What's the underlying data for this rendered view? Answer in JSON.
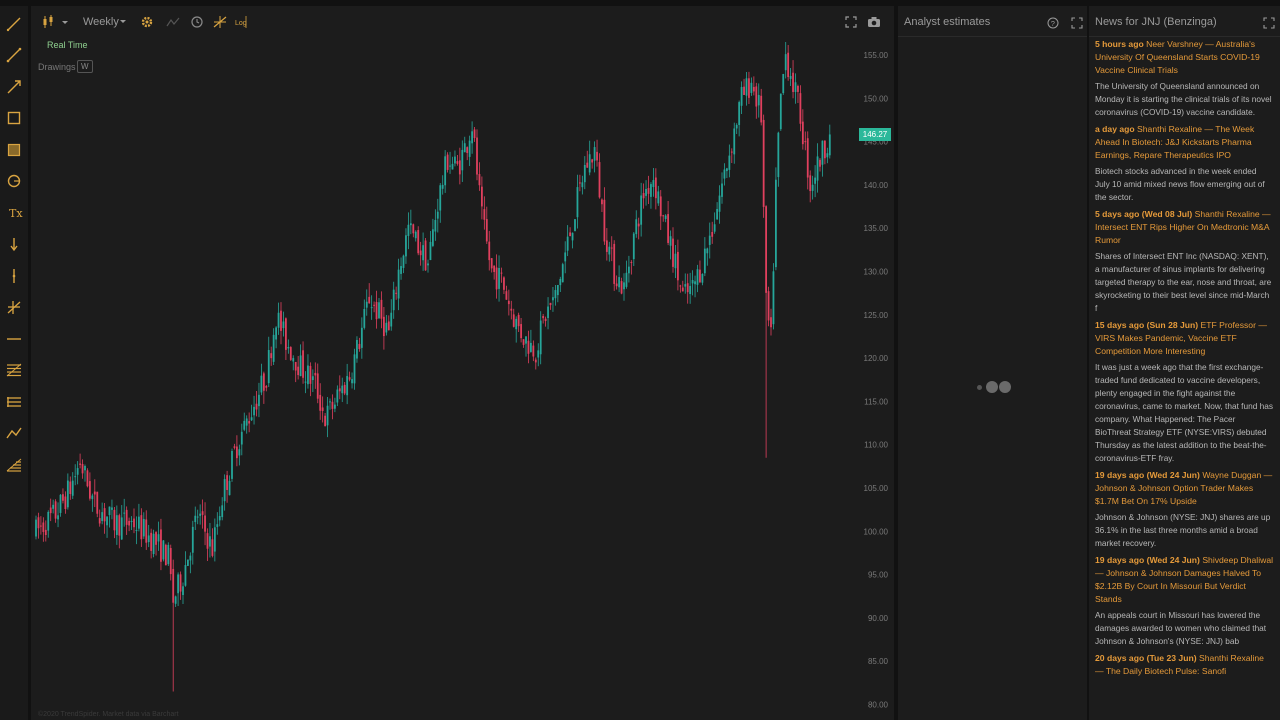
{
  "chart": {
    "timeframe": "Weekly",
    "log_label": "Log",
    "realtime_label": "Real Time",
    "drawings_label": "Drawings",
    "drawings_key": "W",
    "last_price": "146.27",
    "price_axis": [
      "155.00",
      "150.00",
      "145.00",
      "140.00",
      "135.00",
      "130.00",
      "125.00",
      "120.00",
      "115.00",
      "110.00",
      "105.00",
      "100.00",
      "95.00",
      "90.00",
      "85.00",
      "80.00"
    ],
    "copyright": "©2020 TrendSpider. Market data via Barchart",
    "up_color": "#26a69a",
    "down_color": "#e0405e"
  },
  "analyst": {
    "title": "Analyst estimates"
  },
  "news": {
    "title": "News for JNJ (Benzinga)",
    "items": [
      {
        "time": "5 hours ago",
        "headline": "Neer Varshney — Australia's University Of Queensland Starts COVID-19 Vaccine Clinical Trials",
        "summary": "The University of Queensland announced on Monday it is starting the clinical trials of its novel coronavirus (COVID-19) vaccine candidate."
      },
      {
        "time": "a day ago",
        "headline": "Shanthi Rexaline — The Week Ahead In Biotech: J&J Kickstarts Pharma Earnings, Repare Therapeutics IPO",
        "summary": "Biotech stocks advanced in the week ended July 10 amid mixed news flow emerging out of the sector."
      },
      {
        "time": "5 days ago (Wed 08 Jul)",
        "headline": "Shanthi Rexaline — Intersect ENT Rips Higher On Medtronic M&A Rumor",
        "summary": "Shares of Intersect ENT Inc (NASDAQ: XENT), a manufacturer of sinus implants for delivering targeted therapy to the ear, nose and throat, are skyrocketing to their best level since mid-March f"
      },
      {
        "time": "15 days ago (Sun 28 Jun)",
        "headline": "ETF Professor — VIRS Makes Pandemic, Vaccine ETF Competition More Interesting",
        "summary": "It was just a week ago that the first exchange-traded fund dedicated to vaccine developers, plenty engaged in the fight against the coronavirus, came to market. Now, that fund has company. What Happened: The Pacer BioThreat Strategy ETF (NYSE:VIRS) debuted Thursday as the latest addition to the beat-the-coronavirus-ETF fray."
      },
      {
        "time": "19 days ago (Wed 24 Jun)",
        "headline": "Wayne Duggan — Johnson & Johnson Option Trader Makes $1.7M Bet On 17% Upside",
        "summary": "Johnson & Johnson (NYSE: JNJ) shares are up 36.1% in the last three months amid a broad market recovery."
      },
      {
        "time": "19 days ago (Wed 24 Jun)",
        "headline": "Shivdeep Dhaliwal — Johnson & Johnson Damages Halved To $2.12B By Court In Missouri But Verdict Stands",
        "summary": "An appeals court in Missouri has lowered the damages awarded to women who claimed that Johnson & Johnson's (NYSE: JNJ) bab"
      },
      {
        "time": "20 days ago (Tue 23 Jun)",
        "headline": "Shanthi Rexaline — The Daily Biotech Pulse: Sanofi",
        "summary": ""
      }
    ]
  },
  "tools": [
    {
      "name": "pencil-tool-icon"
    },
    {
      "name": "trendline-tool-icon"
    },
    {
      "name": "ray-tool-icon"
    },
    {
      "name": "rectangle-tool-icon"
    },
    {
      "name": "fill-rectangle-tool-icon"
    },
    {
      "name": "circle-tool-icon"
    },
    {
      "name": "text-tool-icon"
    },
    {
      "name": "arrow-down-tool-icon"
    },
    {
      "name": "vertical-line-tool-icon"
    },
    {
      "name": "cross-line-tool-icon"
    },
    {
      "name": "horizontal-line-tool-icon"
    },
    {
      "name": "fibonacci-tool-icon"
    },
    {
      "name": "channel-tool-icon"
    },
    {
      "name": "polyline-tool-icon"
    },
    {
      "name": "fan-tool-icon"
    }
  ]
}
